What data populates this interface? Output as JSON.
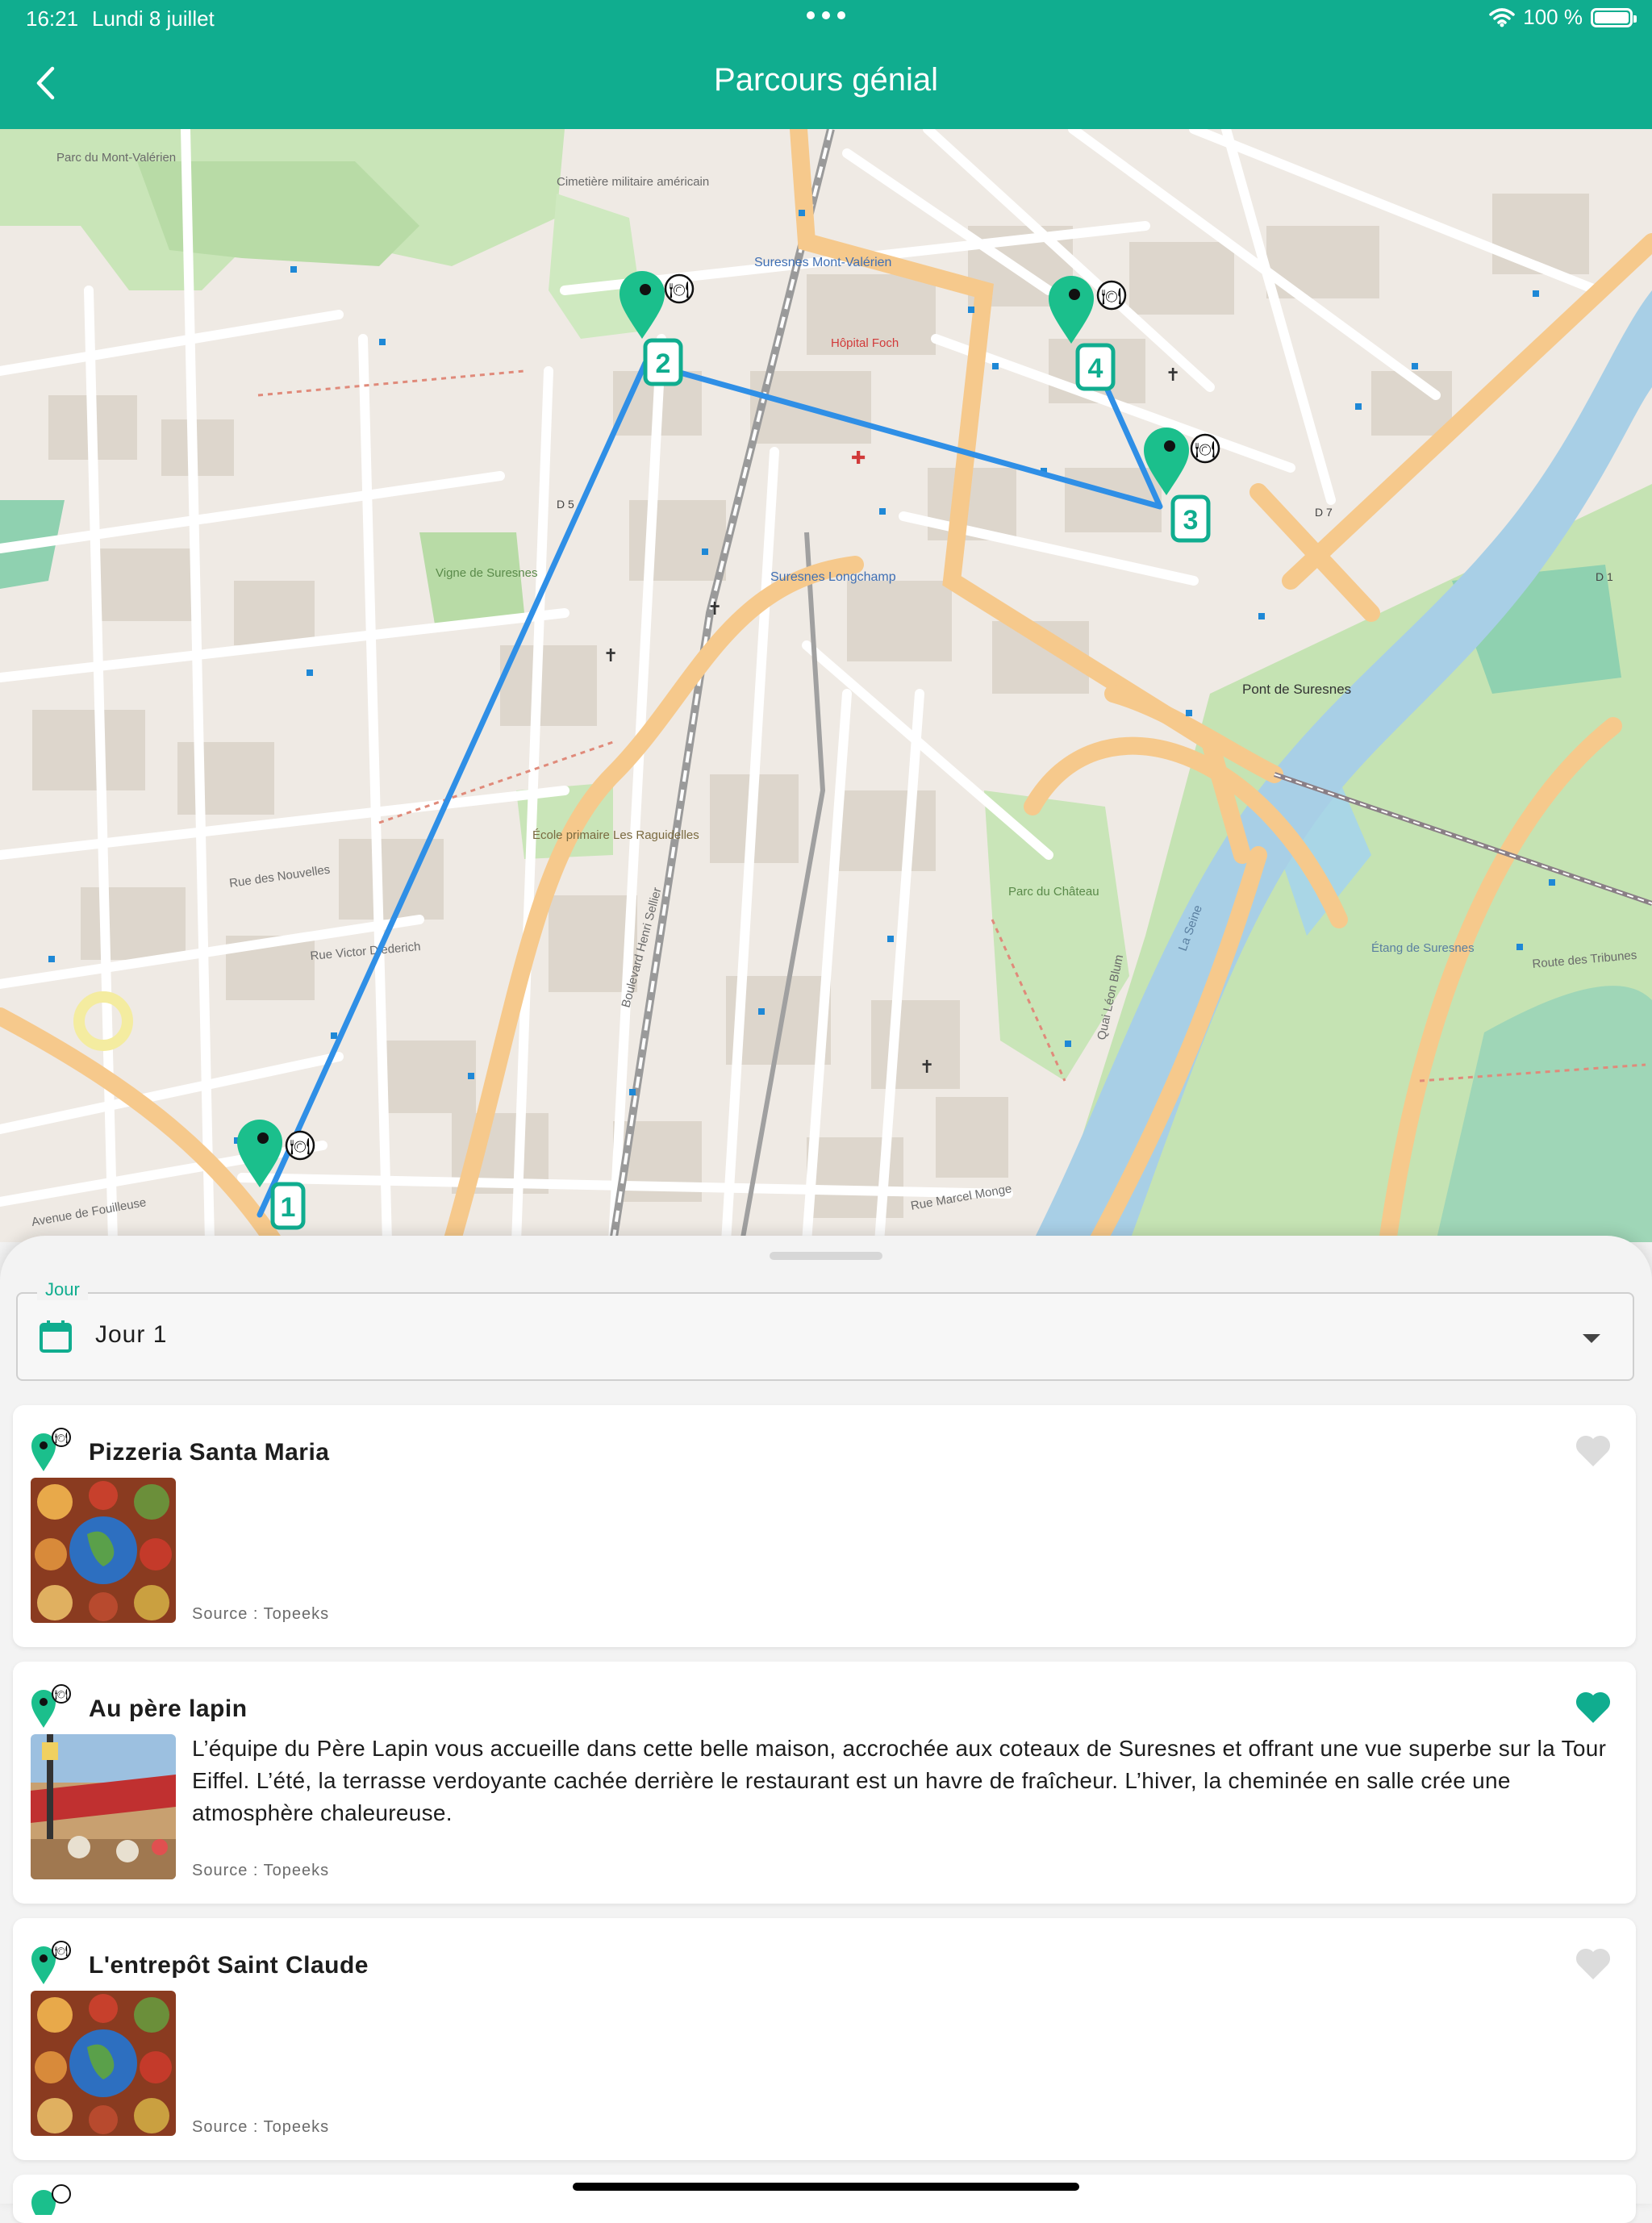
{
  "status_bar": {
    "time": "16:21",
    "date": "Lundi 8 juillet",
    "battery": "100 %"
  },
  "header": {
    "title": "Parcours génial",
    "accent_color": "#10ad8f"
  },
  "map": {
    "route_color": "#2f8fe6",
    "stops": [
      {
        "number": "1",
        "type": "restaurant"
      },
      {
        "number": "2",
        "type": "restaurant"
      },
      {
        "number": "3",
        "type": "restaurant"
      },
      {
        "number": "4",
        "type": "restaurant"
      }
    ],
    "labels": {
      "parc_mont_valerien": "Parc du Mont-Valérien",
      "cimetiere": "Cimetière militaire américain",
      "suresnes_mv": "Suresnes Mont-Valérien",
      "hopital": "Hôpital Foch",
      "suresnes_lc": "Suresnes Longchamp",
      "pont": "Pont de Suresnes",
      "vigne": "Vigne de Suresnes",
      "ecole": "École primaire Les Raguidelles",
      "parc_chateau": "Parc du Château",
      "la_seine": "La Seine",
      "quai_leon_blum": "Quai Léon Blum",
      "bd_henri_sellier": "Boulevard Henri Sellier",
      "rue_des_nouvelles": "Rue des Nouvelles",
      "rue_victor_diederich": "Rue Victor Diederich",
      "rue_marcel_monge": "Rue Marcel Monge",
      "avenue_fouilleuse": "Avenue de Fouilleuse",
      "route_tribunes": "Route des Tribunes",
      "etang": "Étang de Suresnes",
      "d7": "D 7",
      "d1": "D 1",
      "d5": "D 5"
    }
  },
  "day_selector": {
    "legend": "Jour",
    "value": "Jour 1"
  },
  "places": [
    {
      "name": "Pizzeria Santa Maria",
      "description": "",
      "source": "Source : Topeeks",
      "favorite": false,
      "thumb": "food-collage"
    },
    {
      "name": "Au père lapin",
      "description": "L’équipe du Père Lapin vous accueille dans cette belle maison, accrochée aux coteaux de Suresnes et offrant une vue superbe sur la Tour Eiffel. L’été, la terrasse verdoyante cachée derrière le restaurant est un havre de fraîcheur. L’hiver, la cheminée en salle crée une atmosphère chaleureuse.",
      "source": "Source : Topeeks",
      "favorite": true,
      "thumb": "terrace"
    },
    {
      "name": "L'entrepôt Saint Claude",
      "description": "",
      "source": "Source : Topeeks",
      "favorite": false,
      "thumb": "food-collage"
    }
  ],
  "colors": {
    "favorite_on": "#10ad8f",
    "favorite_off": "#dcdcdc"
  }
}
